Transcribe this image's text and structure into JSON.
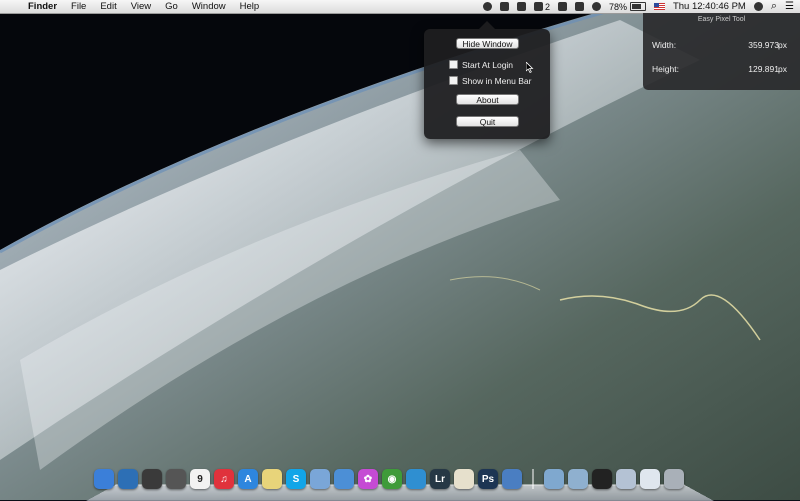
{
  "menubar": {
    "app_name": "Finder",
    "menus": [
      "File",
      "Edit",
      "View",
      "Go",
      "Window",
      "Help"
    ],
    "status": {
      "badge_count": "2",
      "battery_percent": "78%",
      "clock": "Thu 12:40:46 PM"
    }
  },
  "popover": {
    "hide_window_label": "Hide Window",
    "start_at_login_label": "Start At Login",
    "start_at_login_checked": false,
    "show_in_menu_bar_label": "Show in Menu Bar",
    "show_in_menu_bar_checked": false,
    "about_label": "About",
    "quit_label": "Quit"
  },
  "pixel_tool": {
    "title": "Easy Pixel Tool",
    "width_label": "Width:",
    "width_value": "359.973",
    "height_label": "Height:",
    "height_value": "129.891",
    "unit": "px"
  },
  "dock": {
    "calendar_day": "9",
    "items": [
      {
        "name": "finder-icon",
        "color": "#3b7fd9",
        "glyph": ""
      },
      {
        "name": "mission-control-icon",
        "color": "#2d6fb5",
        "glyph": ""
      },
      {
        "name": "dashboard-icon",
        "color": "#3a3a3a",
        "glyph": ""
      },
      {
        "name": "launchpad-icon",
        "color": "#555",
        "glyph": ""
      },
      {
        "name": "calendar-icon",
        "color": "#f2f2f2",
        "glyph": "9"
      },
      {
        "name": "itunes-icon",
        "color": "#e0323c",
        "glyph": "♫"
      },
      {
        "name": "app-store-icon",
        "color": "#2e86de",
        "glyph": "A"
      },
      {
        "name": "notes-icon",
        "color": "#e8d47a",
        "glyph": ""
      },
      {
        "name": "skype-icon",
        "color": "#12a5e8",
        "glyph": "S"
      },
      {
        "name": "preview-icon",
        "color": "#7aa6d8",
        "glyph": ""
      },
      {
        "name": "safari-icon",
        "color": "#4c8fd6",
        "glyph": ""
      },
      {
        "name": "flower-app-icon",
        "color": "#c54bd4",
        "glyph": "✿"
      },
      {
        "name": "chrome-icon",
        "color": "#3f9b3a",
        "glyph": "◉"
      },
      {
        "name": "twitter-icon",
        "color": "#2f8fd1",
        "glyph": ""
      },
      {
        "name": "lightroom-icon",
        "color": "#263845",
        "glyph": "Lr"
      },
      {
        "name": "textedit-icon",
        "color": "#e6e0cc",
        "glyph": ""
      },
      {
        "name": "photoshop-icon",
        "color": "#1d3553",
        "glyph": "Ps"
      },
      {
        "name": "xcode-icon",
        "color": "#4a7ec2",
        "glyph": ""
      },
      {
        "name": "applications-folder-icon",
        "color": "#7fa8cf",
        "glyph": ""
      },
      {
        "name": "documents-folder-icon",
        "color": "#8fb0cf",
        "glyph": ""
      },
      {
        "name": "terminal-icon",
        "color": "#222",
        "glyph": ""
      },
      {
        "name": "stacks-icon",
        "color": "#b4c2d4",
        "glyph": ""
      },
      {
        "name": "downloads-icon",
        "color": "#dfe6ee",
        "glyph": ""
      },
      {
        "name": "trash-icon",
        "color": "#a9b0b8",
        "glyph": ""
      }
    ]
  }
}
